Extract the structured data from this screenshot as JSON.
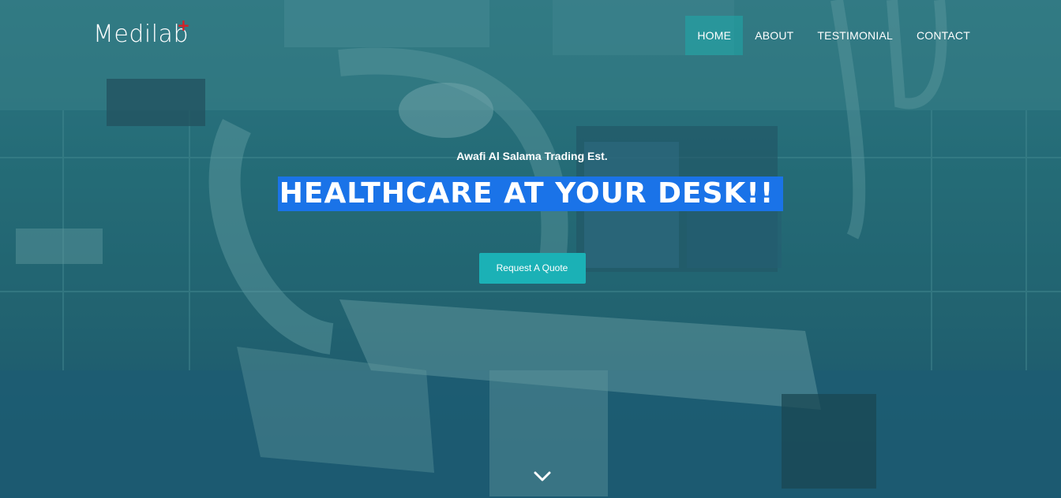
{
  "brand": {
    "name": "Medilab",
    "plus": "+"
  },
  "nav": {
    "items": [
      {
        "label": "HOME",
        "active": true
      },
      {
        "label": "ABOUT",
        "active": false
      },
      {
        "label": "TESTIMONIAL",
        "active": false
      },
      {
        "label": "CONTACT",
        "active": false
      }
    ]
  },
  "hero": {
    "company": "Awafi Al Salama Trading Est.",
    "headline": "HEALTHCARE AT YOUR DESK!!",
    "cta_label": "Request A Quote",
    "scroll_icon": "chevron-down-icon"
  },
  "colors": {
    "overlay": "#2f7580",
    "accent": "#1bb1b6",
    "headline_highlight": "#1a73e8",
    "logo_plus": "#d71f26"
  }
}
